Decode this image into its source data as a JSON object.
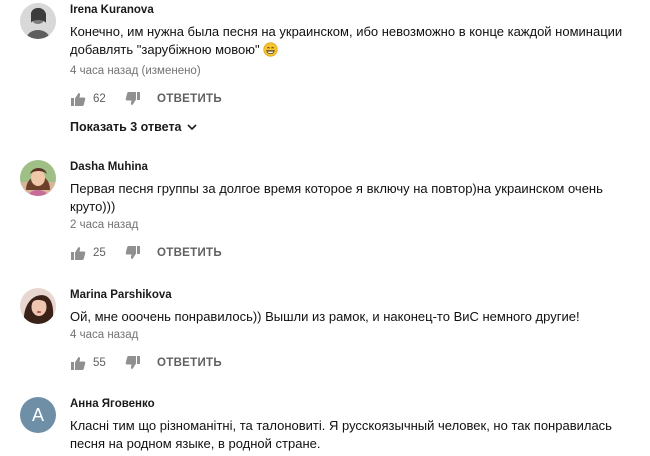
{
  "colors": {
    "text": "#111111",
    "muted": "#606060",
    "avatar_letter_bg": "#6f8fa7"
  },
  "comments": [
    {
      "author": "Irena Kuranova",
      "text": "Конечно, им нужна была песня на украинском, ибо невозможно в конце каждой номинации добавлять \"зарубіжною мовою\"",
      "emoji": "grinning-face-emoji",
      "time": "4 часа назад (изменено)",
      "likes": "62",
      "reply_label": "ОТВЕТИТЬ",
      "show_replies_label": "Показать 3 ответа"
    },
    {
      "author": "Dasha Muhina",
      "text": "Первая песня группы за долгое время которое я включу на повтор)на украинском очень круто)))",
      "time": "2 часа назад",
      "likes": "25",
      "reply_label": "ОТВЕТИТЬ"
    },
    {
      "author": "Marina Parshikova",
      "text": "Ой, мне ооочень понравилось)) Вышли из рамок, и наконец-то ВиС немного другие!",
      "time": "4 часа назад",
      "likes": "55",
      "reply_label": "ОТВЕТИТЬ"
    },
    {
      "author": "Анна Яговенко",
      "avatar_letter": "А",
      "text": "Класні тим що різноманітні, та талоновиті. Я русскоязычный человек, но так понравилась песня на родном языке, в родной стране."
    }
  ]
}
